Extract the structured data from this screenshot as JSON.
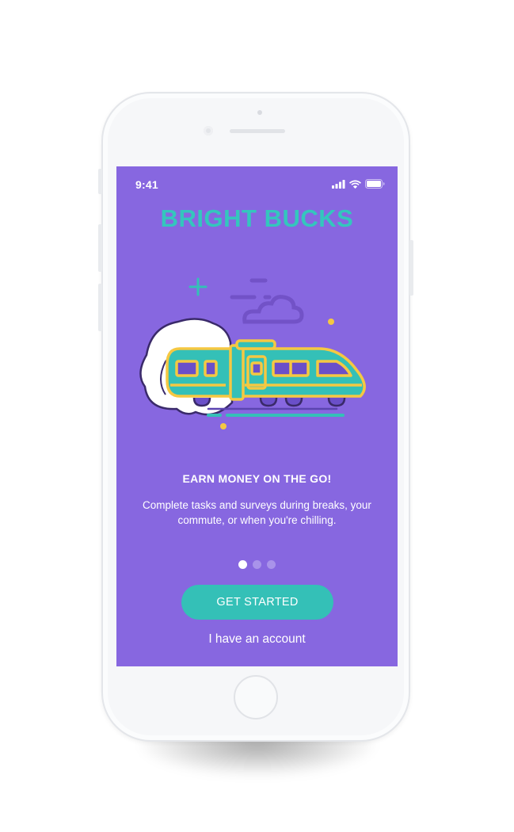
{
  "status_bar": {
    "time": "9:41",
    "icons": [
      "cellular-signal-icon",
      "wifi-icon",
      "battery-icon"
    ]
  },
  "onboarding": {
    "brand_title": "BRIGHT BUCKS",
    "illustration": "train-icon",
    "headline": "EARN MONEY ON THE GO!",
    "description": "Complete tasks and surveys during breaks, your commute, or when you're chilling.",
    "pagination": {
      "total": 3,
      "active_index": 0
    },
    "primary_button_label": "GET STARTED",
    "secondary_link_label": "I have an account"
  },
  "colors": {
    "screen_background": "#8767e0",
    "brand": "#34c6bd",
    "button": "#34c0b7",
    "train_body": "#34c0b7",
    "train_outline": "#f5c842",
    "smoke": "#ffffff"
  }
}
